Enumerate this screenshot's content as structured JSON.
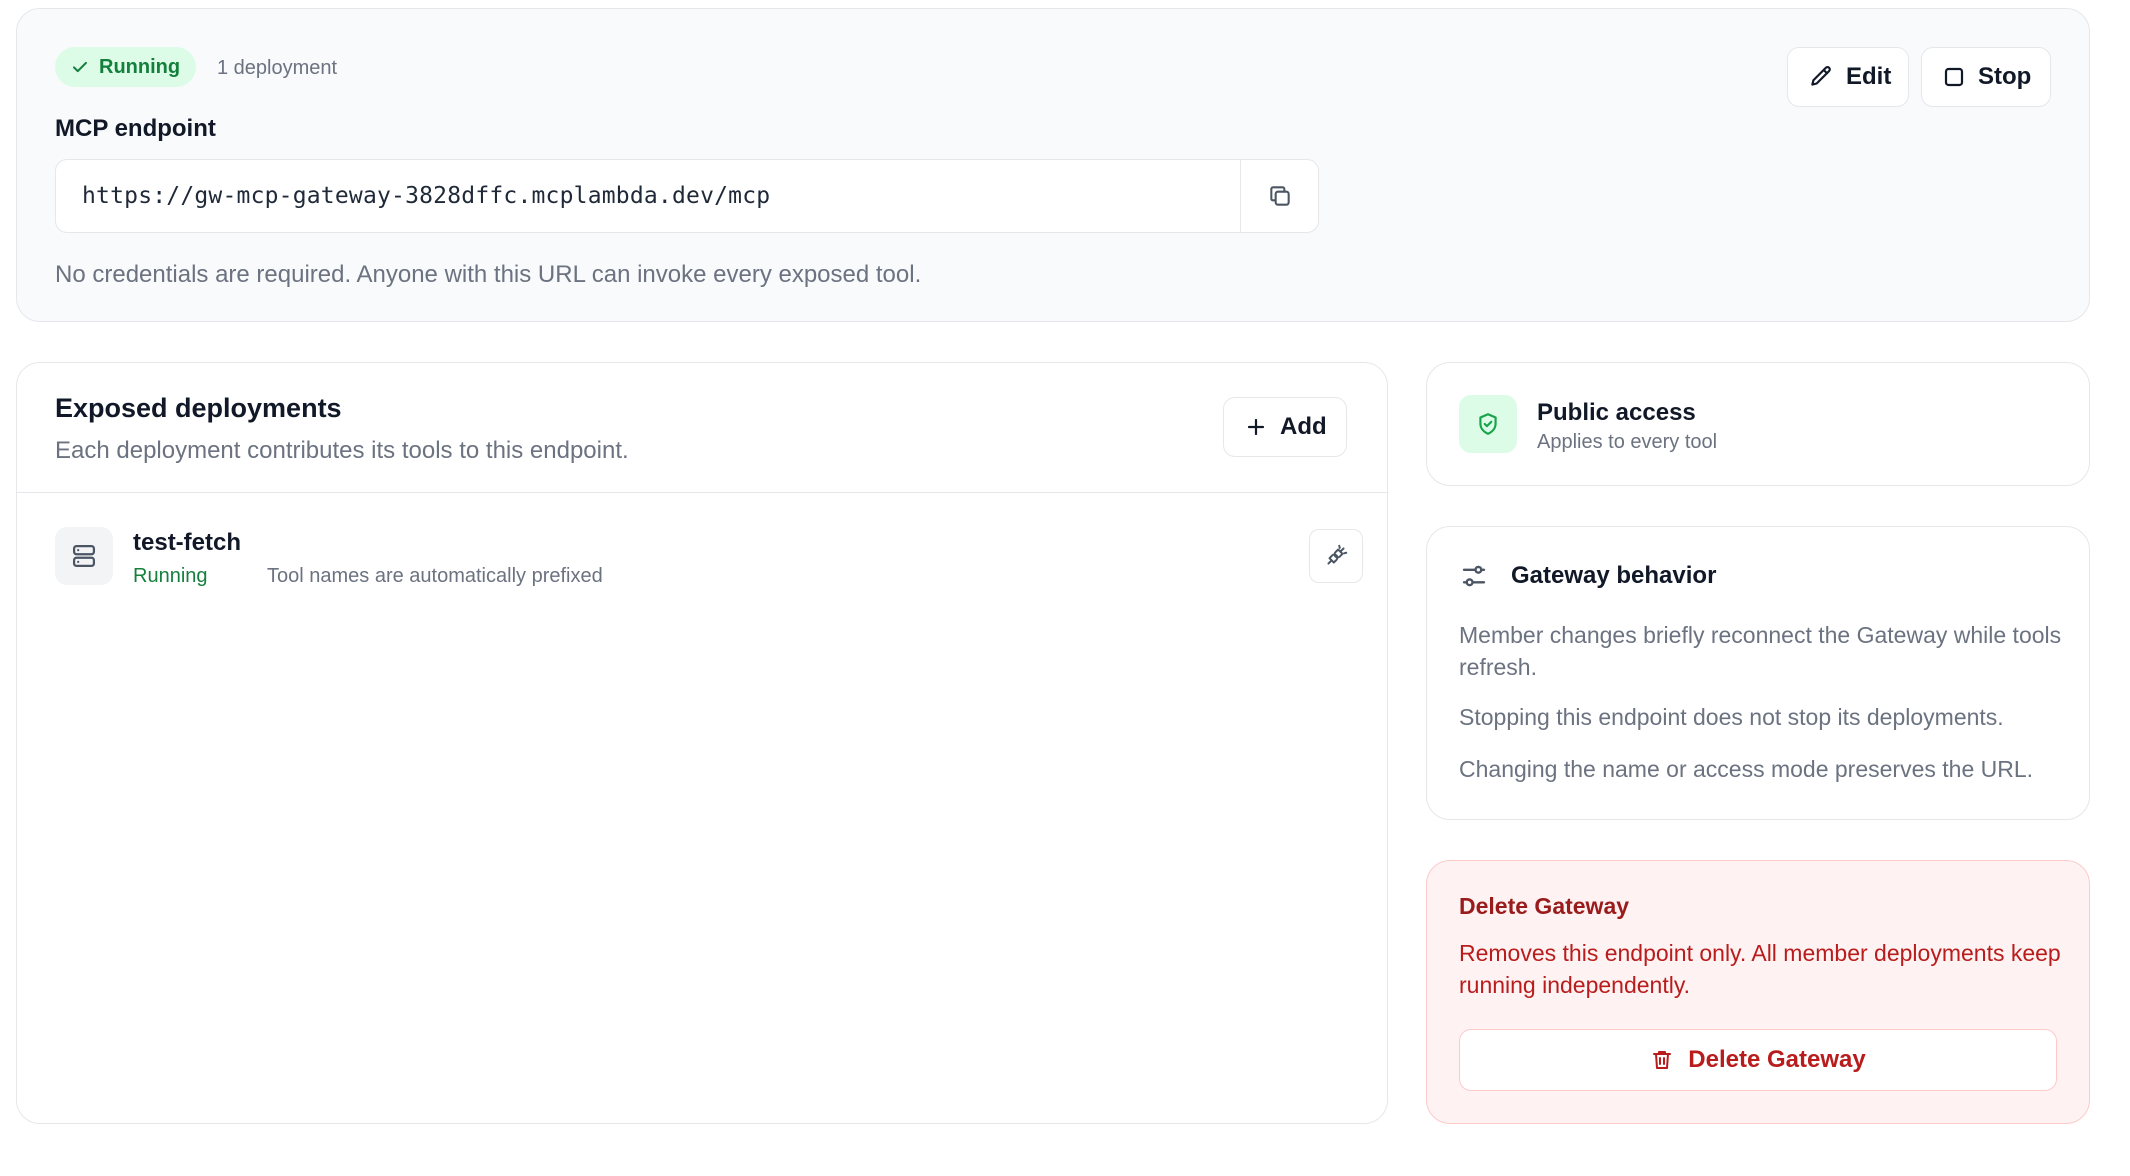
{
  "status": {
    "badge_label": "Running",
    "deployment_count": "1 deployment",
    "edit_label": "Edit",
    "stop_label": "Stop",
    "endpoint_label": "MCP endpoint",
    "endpoint_url": "https://gw-mcp-gateway-3828dffc.mcplambda.dev/mcp",
    "credentials_note": "No credentials are required. Anyone with this URL can invoke every exposed tool."
  },
  "deployments": {
    "title": "Exposed deployments",
    "subtitle": "Each deployment contributes its tools to this endpoint.",
    "add_label": "Add",
    "items": [
      {
        "name": "test-fetch",
        "status": "Running",
        "note": "Tool names are automatically prefixed",
        "icon": "server-icon",
        "action_icon": "unplug-icon"
      }
    ]
  },
  "access": {
    "title": "Public access",
    "subtitle": "Applies to every tool",
    "icon": "shield-check-icon"
  },
  "behavior": {
    "title": "Gateway behavior",
    "icon": "sliders-icon",
    "paragraphs": [
      "Member changes briefly reconnect the Gateway while tools refresh.",
      "Stopping this endpoint does not stop its deployments.",
      "Changing the name or access mode preserves the URL."
    ]
  },
  "danger": {
    "title": "Delete Gateway",
    "text": "Removes this endpoint only. All member deployments keep running independently.",
    "button_label": "Delete Gateway",
    "icon": "trash-icon"
  },
  "colors": {
    "success": "#15803d",
    "success_bg": "#dcfce7",
    "danger": "#b91c1c",
    "danger_bg": "#fef2f2",
    "border": "#e5e7eb",
    "muted_text": "#6b7280"
  }
}
